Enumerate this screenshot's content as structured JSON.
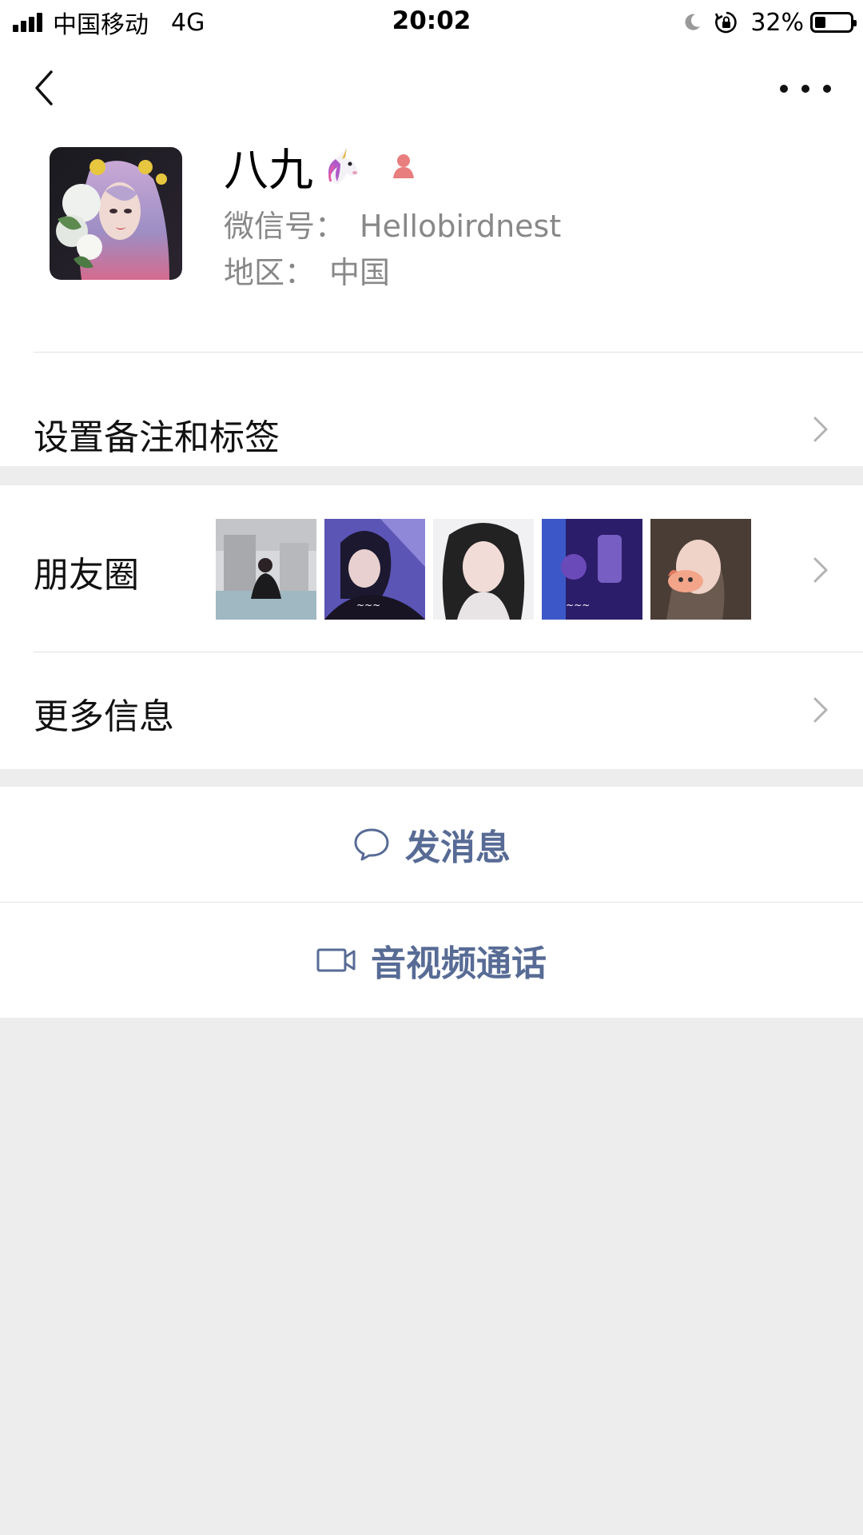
{
  "status_bar": {
    "carrier": "中国移动",
    "network": "4G",
    "time": "20:02",
    "battery_percent": "32%",
    "battery_level": 0.32
  },
  "profile": {
    "name": "八九",
    "wechat_id_label": "微信号：",
    "wechat_id": "Hellobirdnest",
    "region_label": "地区：",
    "region": "中国",
    "gender": "female"
  },
  "rows": {
    "tags_label": "设置备注和标签",
    "moments_label": "朋友圈",
    "more_info_label": "更多信息"
  },
  "actions": {
    "message_label": "发消息",
    "call_label": "音视频通话"
  },
  "colors": {
    "accent_link": "#576b95",
    "background": "#ededed",
    "gender_female": "#e87e7e"
  },
  "icons": {
    "back": "chevron-left-icon",
    "more": "more-dots-icon",
    "message": "chat-bubble-icon",
    "call": "video-camera-icon"
  }
}
